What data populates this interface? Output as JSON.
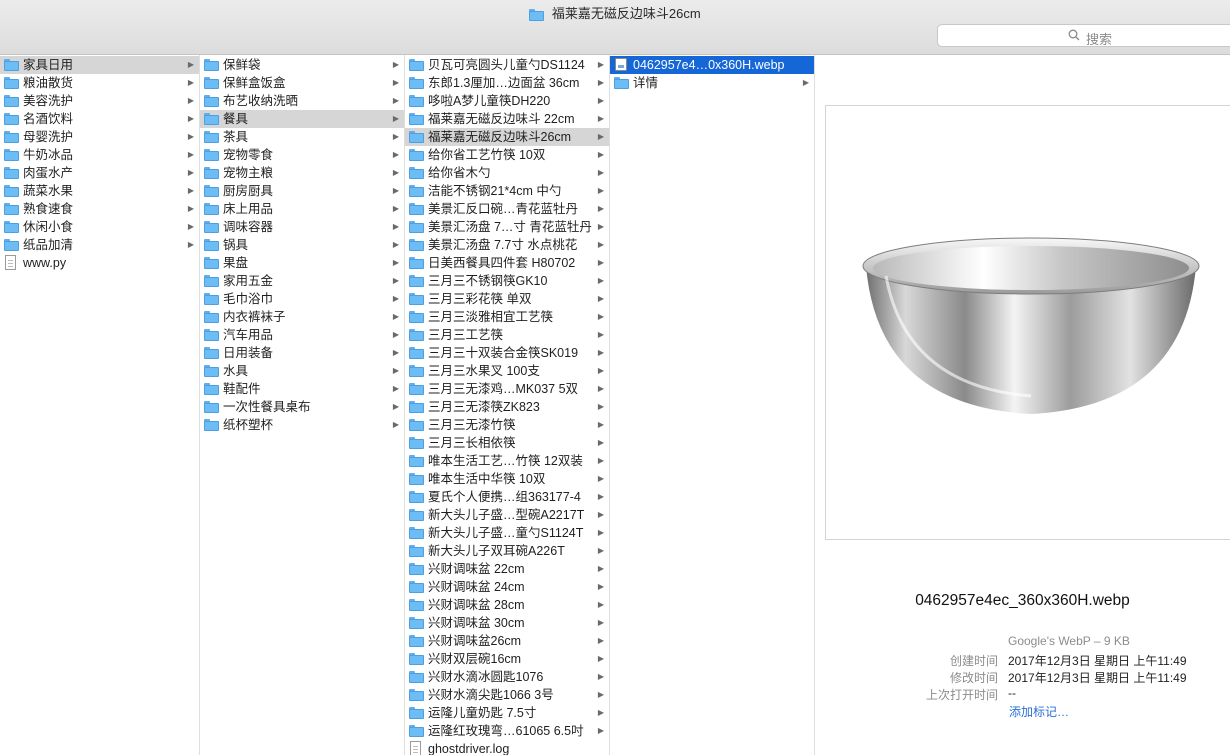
{
  "window": {
    "title": "福莱嘉无磁反边味斗26cm",
    "search_placeholder": "搜索"
  },
  "column1": {
    "items": [
      {
        "label": "家具日用",
        "type": "folder",
        "selected": "inactive"
      },
      {
        "label": "粮油散货",
        "type": "folder"
      },
      {
        "label": "美容洗护",
        "type": "folder"
      },
      {
        "label": "名酒饮料",
        "type": "folder"
      },
      {
        "label": "母婴洗护",
        "type": "folder"
      },
      {
        "label": "牛奶冰品",
        "type": "folder"
      },
      {
        "label": "肉蛋水产",
        "type": "folder"
      },
      {
        "label": "蔬菜水果",
        "type": "folder"
      },
      {
        "label": "熟食速食",
        "type": "folder"
      },
      {
        "label": "休闲小食",
        "type": "folder"
      },
      {
        "label": "纸品加清",
        "type": "folder"
      },
      {
        "label": "www.py",
        "type": "file"
      }
    ]
  },
  "column2": {
    "items": [
      {
        "label": "保鲜袋",
        "type": "folder"
      },
      {
        "label": "保鲜盒饭盒",
        "type": "folder"
      },
      {
        "label": "布艺收纳洗晒",
        "type": "folder"
      },
      {
        "label": "餐具",
        "type": "folder",
        "selected": "inactive"
      },
      {
        "label": "茶具",
        "type": "folder"
      },
      {
        "label": "宠物零食",
        "type": "folder"
      },
      {
        "label": "宠物主粮",
        "type": "folder"
      },
      {
        "label": "厨房厨具",
        "type": "folder"
      },
      {
        "label": "床上用品",
        "type": "folder"
      },
      {
        "label": "调味容器",
        "type": "folder"
      },
      {
        "label": "锅具",
        "type": "folder"
      },
      {
        "label": "果盘",
        "type": "folder"
      },
      {
        "label": "家用五金",
        "type": "folder"
      },
      {
        "label": "毛巾浴巾",
        "type": "folder"
      },
      {
        "label": "内衣裤袜子",
        "type": "folder"
      },
      {
        "label": "汽车用品",
        "type": "folder"
      },
      {
        "label": "日用装备",
        "type": "folder"
      },
      {
        "label": "水具",
        "type": "folder"
      },
      {
        "label": "鞋配件",
        "type": "folder"
      },
      {
        "label": "一次性餐具桌布",
        "type": "folder"
      },
      {
        "label": "纸杯塑杯",
        "type": "folder"
      }
    ]
  },
  "column3": {
    "items": [
      {
        "label": "贝瓦可亮圆头儿童勺DS1124",
        "type": "folder"
      },
      {
        "label": "东郎1.3厘加…边面盆 36cm",
        "type": "folder"
      },
      {
        "label": "哆啦A梦儿童筷DH220",
        "type": "folder"
      },
      {
        "label": "福莱嘉无磁反边味斗 22cm",
        "type": "folder"
      },
      {
        "label": "福莱嘉无磁反边味斗26cm",
        "type": "folder",
        "selected": "inactive"
      },
      {
        "label": "给你省工艺竹筷 10双",
        "type": "folder"
      },
      {
        "label": "给你省木勺",
        "type": "folder"
      },
      {
        "label": "洁能不锈钢21*4cm 中勺",
        "type": "folder"
      },
      {
        "label": "美景汇反口碗…青花蓝牡丹",
        "type": "folder"
      },
      {
        "label": "美景汇汤盘 7…寸 青花蓝牡丹",
        "type": "folder"
      },
      {
        "label": "美景汇汤盘 7.7寸 水点桃花",
        "type": "folder"
      },
      {
        "label": "日美西餐具四件套 H80702",
        "type": "folder"
      },
      {
        "label": "三月三不锈钢筷GK10",
        "type": "folder"
      },
      {
        "label": "三月三彩花筷 单双",
        "type": "folder"
      },
      {
        "label": "三月三淡雅相宜工艺筷",
        "type": "folder"
      },
      {
        "label": "三月三工艺筷",
        "type": "folder"
      },
      {
        "label": "三月三十双装合金筷SK019",
        "type": "folder"
      },
      {
        "label": "三月三水果叉 100支",
        "type": "folder"
      },
      {
        "label": "三月三无漆鸡…MK037 5双",
        "type": "folder"
      },
      {
        "label": "三月三无漆筷ZK823",
        "type": "folder"
      },
      {
        "label": "三月三无漆竹筷",
        "type": "folder"
      },
      {
        "label": "三月三长相依筷",
        "type": "folder"
      },
      {
        "label": "唯本生活工艺…竹筷 12双装",
        "type": "folder"
      },
      {
        "label": "唯本生活中华筷 10双",
        "type": "folder"
      },
      {
        "label": "夏氏个人便携…组363177-4",
        "type": "folder"
      },
      {
        "label": "新大头儿子盛…型碗A2217T",
        "type": "folder"
      },
      {
        "label": "新大头儿子盛…童勺S1124T",
        "type": "folder"
      },
      {
        "label": "新大头儿子双耳碗A226T",
        "type": "folder"
      },
      {
        "label": "兴财调味盆 22cm",
        "type": "folder"
      },
      {
        "label": "兴财调味盆 24cm",
        "type": "folder"
      },
      {
        "label": "兴财调味盆 28cm",
        "type": "folder"
      },
      {
        "label": "兴财调味盆 30cm",
        "type": "folder"
      },
      {
        "label": "兴财调味盆26cm",
        "type": "folder"
      },
      {
        "label": "兴财双层碗16cm",
        "type": "folder"
      },
      {
        "label": "兴财水滴冰圆匙1076",
        "type": "folder"
      },
      {
        "label": "兴财水滴尖匙1066 3号",
        "type": "folder"
      },
      {
        "label": "运隆儿童奶匙 7.5寸",
        "type": "folder"
      },
      {
        "label": "运隆红玫瑰弯…61065 6.5吋",
        "type": "folder"
      },
      {
        "label": "ghostdriver.log",
        "type": "file"
      }
    ]
  },
  "column4": {
    "items": [
      {
        "label": "0462957e4…0x360H.webp",
        "type": "image",
        "selected": "active"
      },
      {
        "label": "详情",
        "type": "folder"
      }
    ]
  },
  "preview": {
    "filename": "0462957e4ec_360x360H.webp",
    "kind": "Google's WebP – 9 KB",
    "created_label": "创建时间",
    "created_value": "2017年12月3日 星期日 上午11:49",
    "modified_label": "修改时间",
    "modified_value": "2017年12月3日 星期日 上午11:49",
    "opened_label": "上次打开时间",
    "opened_value": "--",
    "add_tags": "添加标记…"
  },
  "colors": {
    "selection_active": "#1566d6",
    "selection_inactive": "#d6d6d6",
    "folder_blue": "#6cbcf6",
    "link_blue": "#2a6fd6"
  }
}
